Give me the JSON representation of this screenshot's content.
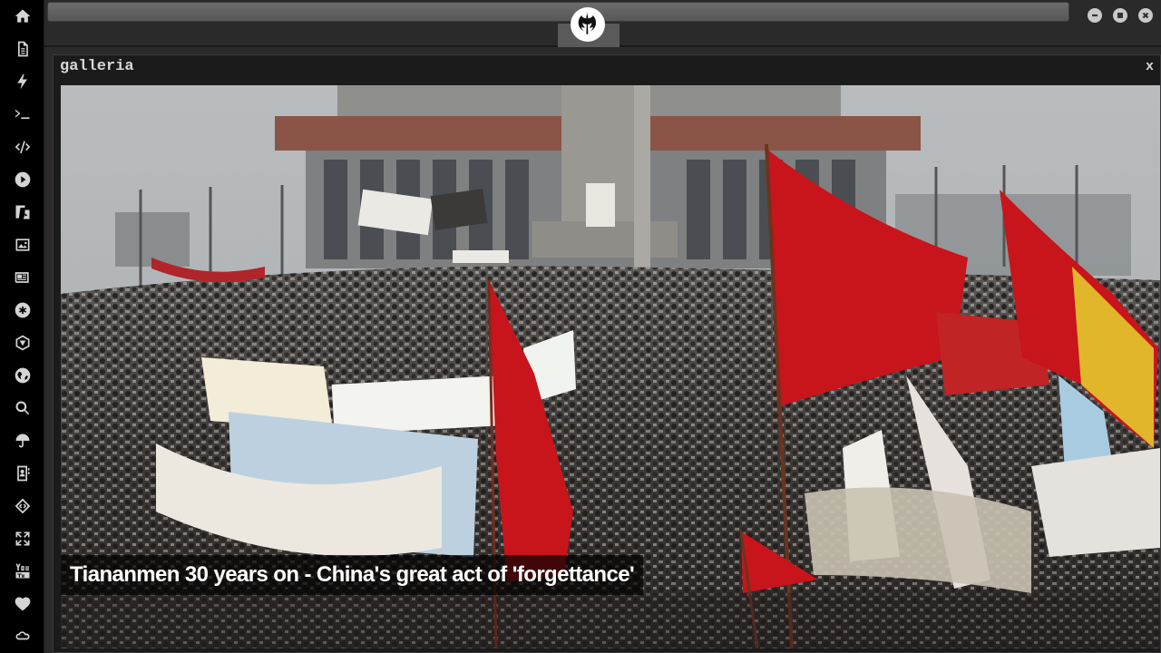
{
  "window": {
    "title": "galleria",
    "close_label": "x"
  },
  "gallery": {
    "caption": "Tiananmen 30 years on - China's great act of 'forgettance'"
  },
  "dock": {
    "items": [
      "home-icon",
      "document-icon",
      "bolt-icon",
      "terminal-icon",
      "code-icon",
      "play-icon",
      "translate-icon",
      "image-icon",
      "newspaper-icon",
      "asterisk-icon",
      "hexagon-icon",
      "globe-icon",
      "search-icon",
      "umbrella-icon",
      "contact-icon",
      "diamond-code-icon",
      "expand-icon",
      "youtube-icon",
      "heart-icon",
      "cloud-icon"
    ]
  },
  "colors": {
    "dock_bg": "#000000",
    "topbar_bg": "#2a2a2a",
    "window_bg": "#1b1b1b",
    "icon_color": "#d4d4d4",
    "flag_red": "#c8141b"
  }
}
